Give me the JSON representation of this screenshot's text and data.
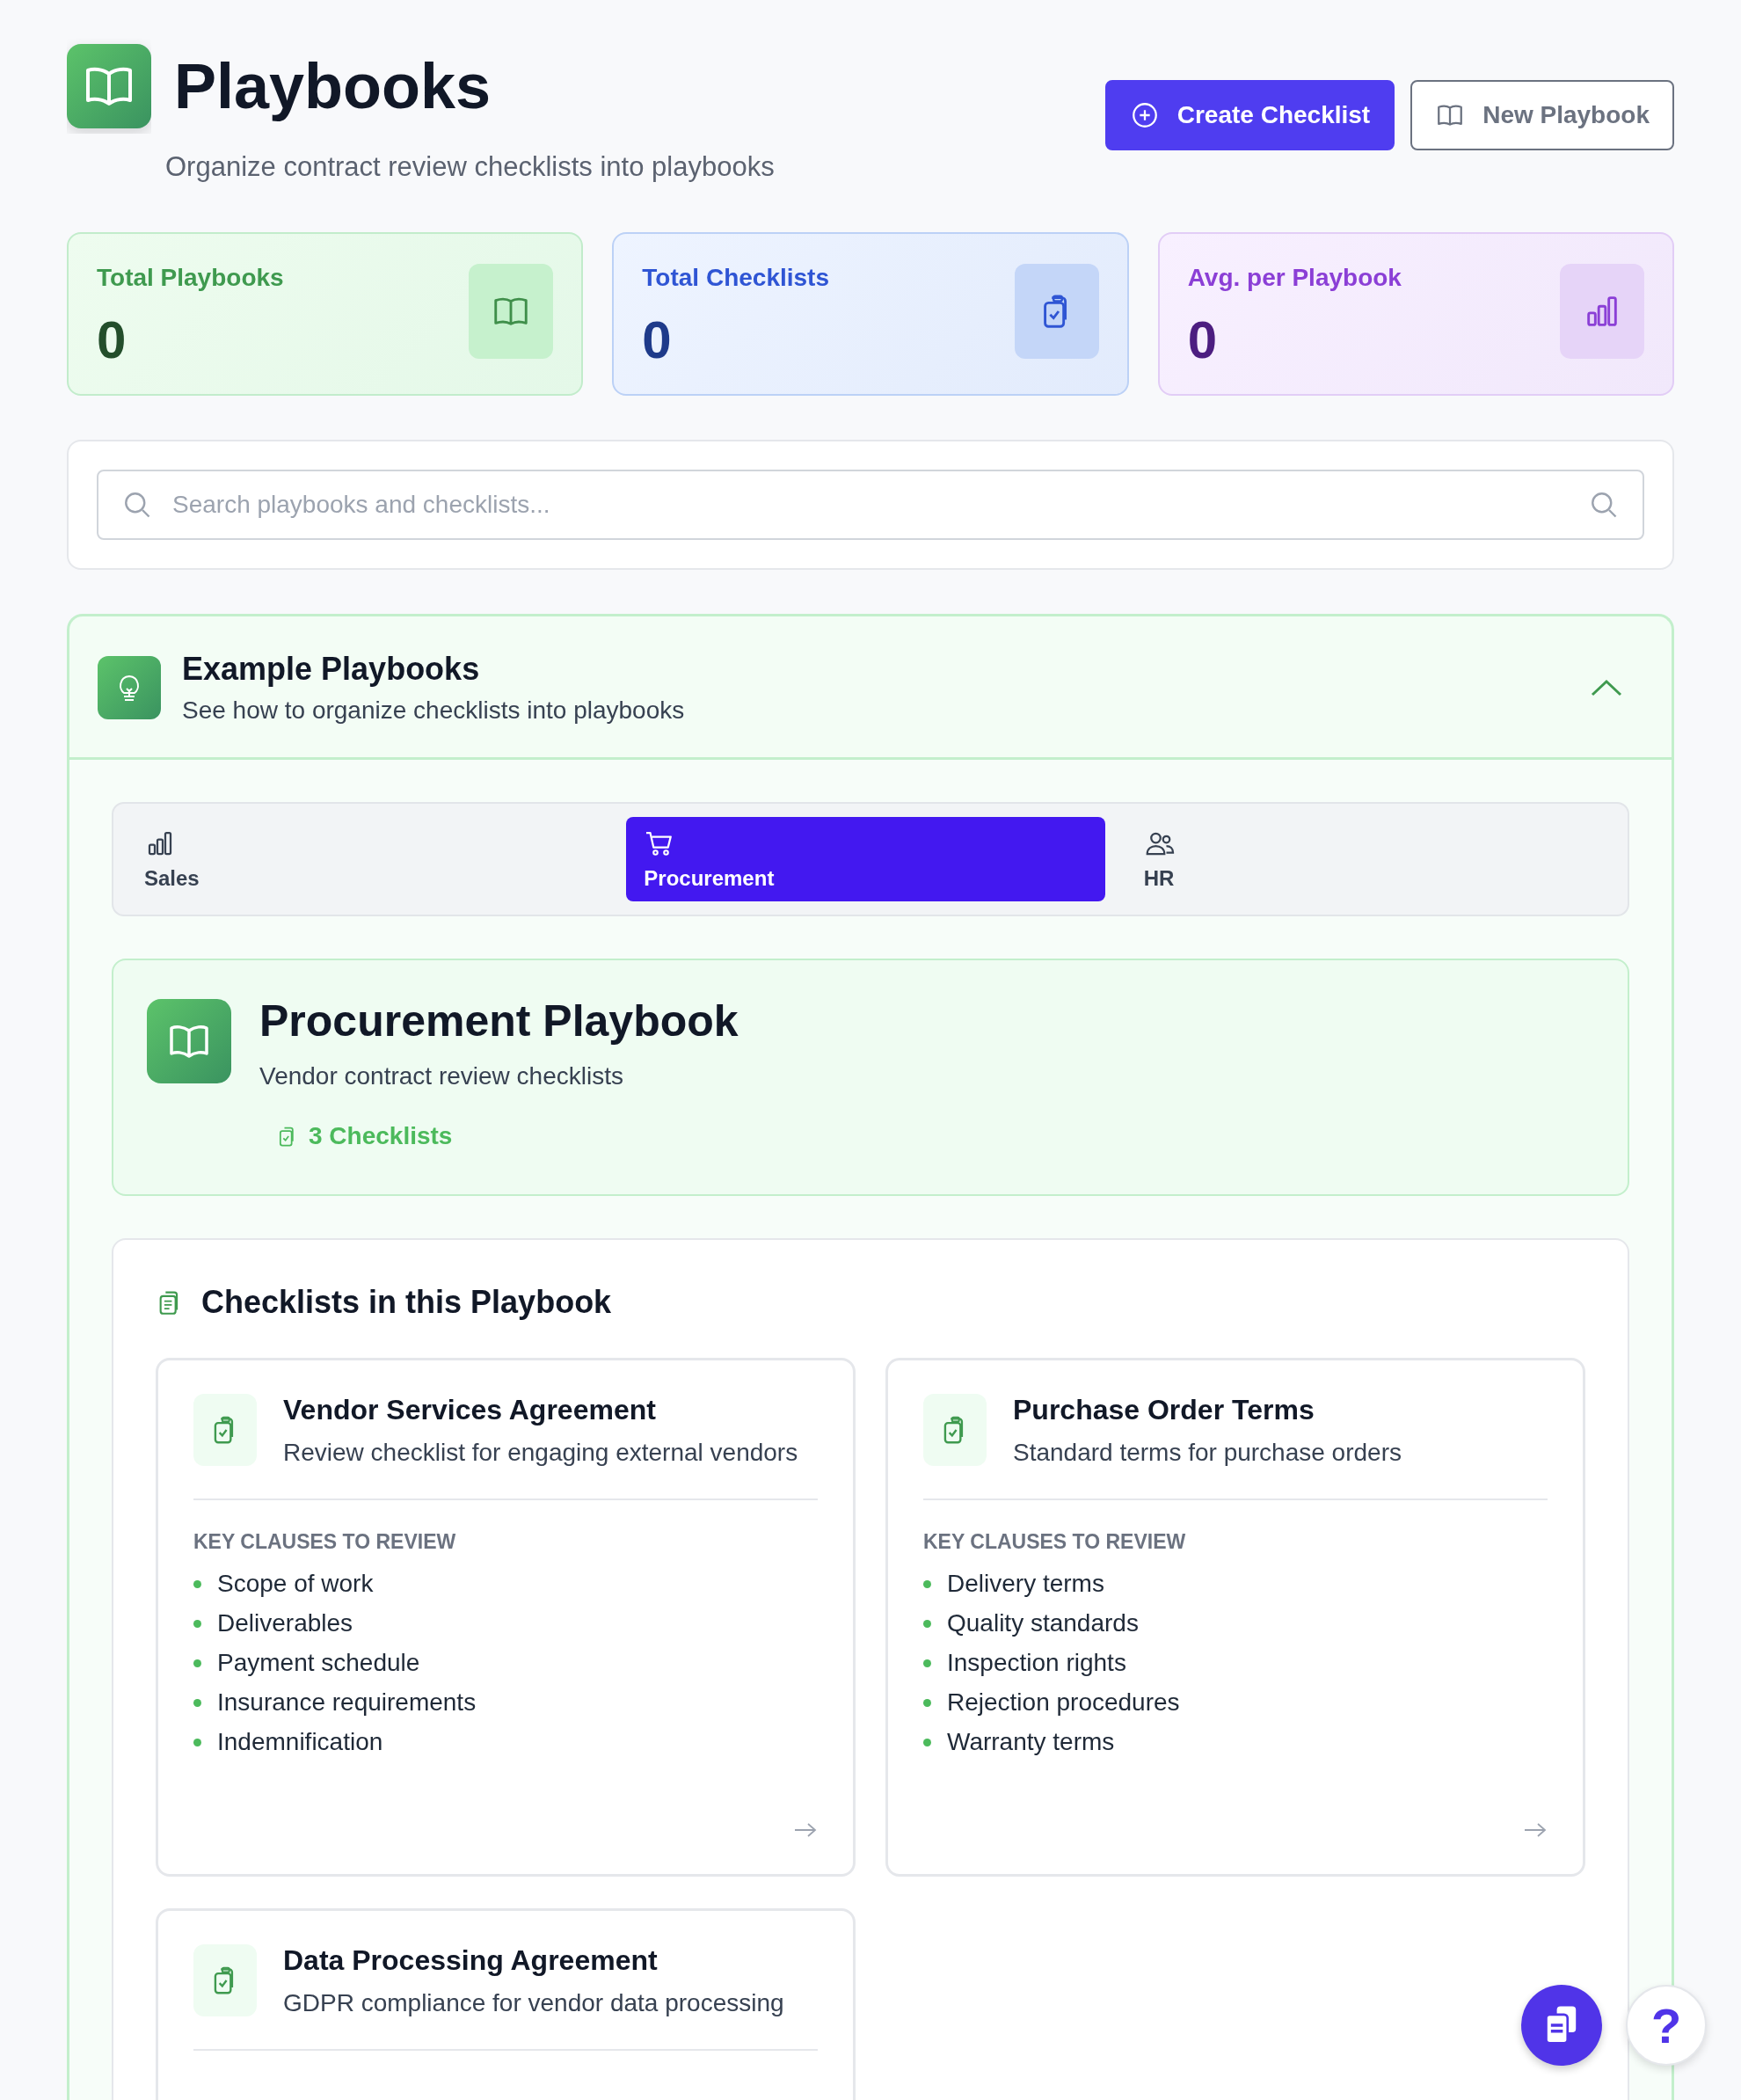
{
  "header": {
    "title": "Playbooks",
    "subtitle": "Organize contract review checklists into playbooks",
    "buttons": [
      {
        "label": "Create Checklist",
        "kind": "primary"
      },
      {
        "label": "New Playbook",
        "kind": "secondary"
      }
    ]
  },
  "stats": [
    {
      "label": "Total Playbooks",
      "value": "0",
      "kind": "book"
    },
    {
      "label": "Total Checklists",
      "value": "0",
      "kind": "clipboard"
    },
    {
      "label": "Avg. per Playbook",
      "value": "0",
      "kind": "chart"
    }
  ],
  "search": {
    "placeholder": "Search playbooks and checklists..."
  },
  "examples": {
    "title": "Example Playbooks",
    "subtitle": "See how to organize checklists into playbooks",
    "expanded": true,
    "tabs": [
      {
        "label": "Sales",
        "kind": "chart",
        "selected": false
      },
      {
        "label": "Procurement",
        "kind": "cart",
        "selected": true
      },
      {
        "label": "HR",
        "kind": "people",
        "selected": false
      }
    ],
    "playbook": {
      "title": "Procurement Playbook",
      "subtitle": "Vendor contract review checklists",
      "count": "3 Checklists"
    },
    "checklists_title": "Checklists in this Playbook",
    "checklists": [
      {
        "title": "Vendor Services Agreement",
        "description": "Review checklist for engaging external vendors",
        "clauses_heading": "KEY CLAUSES TO REVIEW",
        "clauses": [
          "Scope of work",
          "Deliverables",
          "Payment schedule",
          "Insurance requirements",
          "Indemnification"
        ]
      },
      {
        "title": "Purchase Order Terms",
        "description": "Standard terms for purchase orders",
        "clauses_heading": "KEY CLAUSES TO REVIEW",
        "clauses": [
          "Delivery terms",
          "Quality standards",
          "Inspection rights",
          "Rejection procedures",
          "Warranty terms"
        ]
      },
      {
        "title": "Data Processing Agreement",
        "description": "GDPR compliance for vendor data processing"
      }
    ]
  },
  "help_button": "?"
}
